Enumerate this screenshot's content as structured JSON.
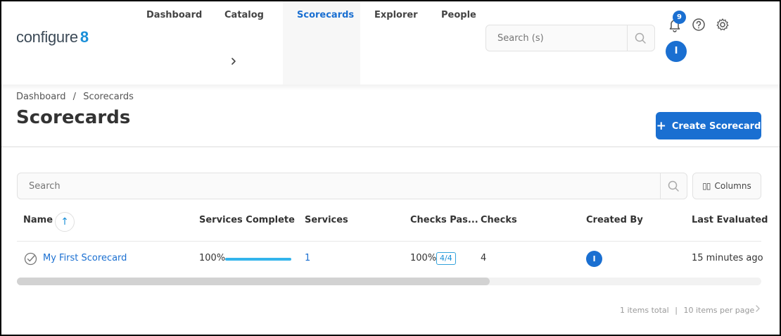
{
  "app": {
    "logo_text": "configure",
    "logo_mark": "8"
  },
  "nav": {
    "items": [
      {
        "label": "Dashboard"
      },
      {
        "label": "Catalog"
      },
      {
        "label": "Scorecards"
      },
      {
        "label": "Explorer"
      },
      {
        "label": "People"
      }
    ],
    "active": "Scorecards",
    "more_icon": "chevron-right-icon"
  },
  "header": {
    "search_placeholder": "Search (s)",
    "notification_count": "9",
    "user_initial": "I",
    "icons": [
      "search-icon",
      "bell-icon",
      "help-icon",
      "gear-icon"
    ]
  },
  "breadcrumb": {
    "items": [
      "Dashboard",
      "Scorecards"
    ],
    "separator": "/"
  },
  "page": {
    "title": "Scorecards",
    "create_label": "Create Scorecard"
  },
  "table": {
    "search_placeholder": "Search",
    "columns_label": "Columns",
    "columns": {
      "name": "Name",
      "services_complete": "Services Complete",
      "services": "Services",
      "checks_passed": "Checks Pas...",
      "checks": "Checks",
      "created_by": "Created By",
      "last_evaluated": "Last Evaluated"
    },
    "rows": [
      {
        "name": "My First Scorecard",
        "services_complete": "100%",
        "services_complete_fraction": 1.0,
        "services": "1",
        "checks_passed": "100%",
        "checks_passed_ratio": "4/4",
        "checks": "4",
        "created_by_initial": "I",
        "last_evaluated": "15 minutes ago"
      }
    ],
    "pagination": {
      "total_text": "1 items total",
      "per_page_text": "10 items per page",
      "separator": "|"
    }
  },
  "colors": {
    "primary": "#1a6fd1",
    "progress": "#33b4ec",
    "link": "#1a6fd1"
  }
}
